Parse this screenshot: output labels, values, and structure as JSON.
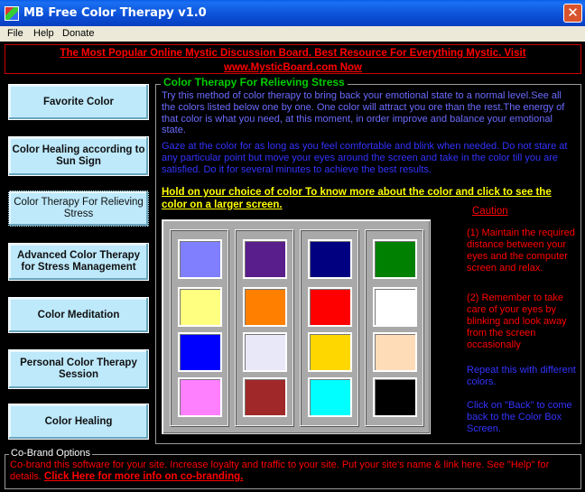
{
  "window": {
    "title": "MB Free Color Therapy v1.0",
    "close_glyph": "✕"
  },
  "menu": [
    {
      "label": "File"
    },
    {
      "label": "Help"
    },
    {
      "label": "Donate"
    }
  ],
  "banner": {
    "line1": "The Most Popular Online Mystic Discussion Board. Best Resource For Everything Mystic. Visit",
    "line2": "www.MysticBoard.com Now"
  },
  "sidebar": [
    {
      "label": "Favorite Color"
    },
    {
      "label": "Color Healing according to Sun Sign"
    },
    {
      "label": "Color Therapy For Relieving Stress"
    },
    {
      "label": "Advanced Color Therapy for Stress Management"
    },
    {
      "label": "Color Meditation"
    },
    {
      "label": "Personal Color Therapy Session"
    },
    {
      "label": "Color Healing"
    }
  ],
  "main": {
    "title": "Color Therapy For Relieving Stress",
    "intro": "Try this method of color therapy to bring back your emotional state to a normal level.See all the colors listed below one by one. One color will attract you ore than the rest.The energy of that color is what you need, at this moment, in order improve and balance your emotional state.",
    "gaze": "Gaze at the color for as long as you feel comfortable and blink when needed. Do not stare at any particular point but move your eyes around the screen and take in the color till you are satisfied. Do it for several minutes to achieve the best results.",
    "hold": "Hold on your choice of color To know more about the color and click to see the color on a larger screen."
  },
  "palette": {
    "columns": [
      [
        "#8080ff",
        "#ffff80",
        "#0000ff",
        "#ff80ff"
      ],
      [
        "#5a1e8c",
        "#ff8000",
        "#e8e8f8",
        "#a02828"
      ],
      [
        "#000080",
        "#ff0000",
        "#ffd700",
        "#00ffff"
      ],
      [
        "#008000",
        "#ffffff",
        "#ffdcb8",
        "#000000"
      ]
    ]
  },
  "caution": {
    "title": "Caution",
    "point1": "(1) Maintain the required distance between your eyes and the computer screen and relax.",
    "point2": "(2) Remember to take care of your eyes by blinking and look away from the screen occasionally",
    "repeat": "Repeat this with different colors.",
    "back": "Click on \"Back\" to come back to the Color Box Screen."
  },
  "cobrand": {
    "title": "Co-Brand Options",
    "text": "Co-brand this software for your site. Increase loyalty and traffic to your site. Put your site's name &  link here. See \"Help\" for details.",
    "link": "Click Here for more info on co-branding."
  }
}
